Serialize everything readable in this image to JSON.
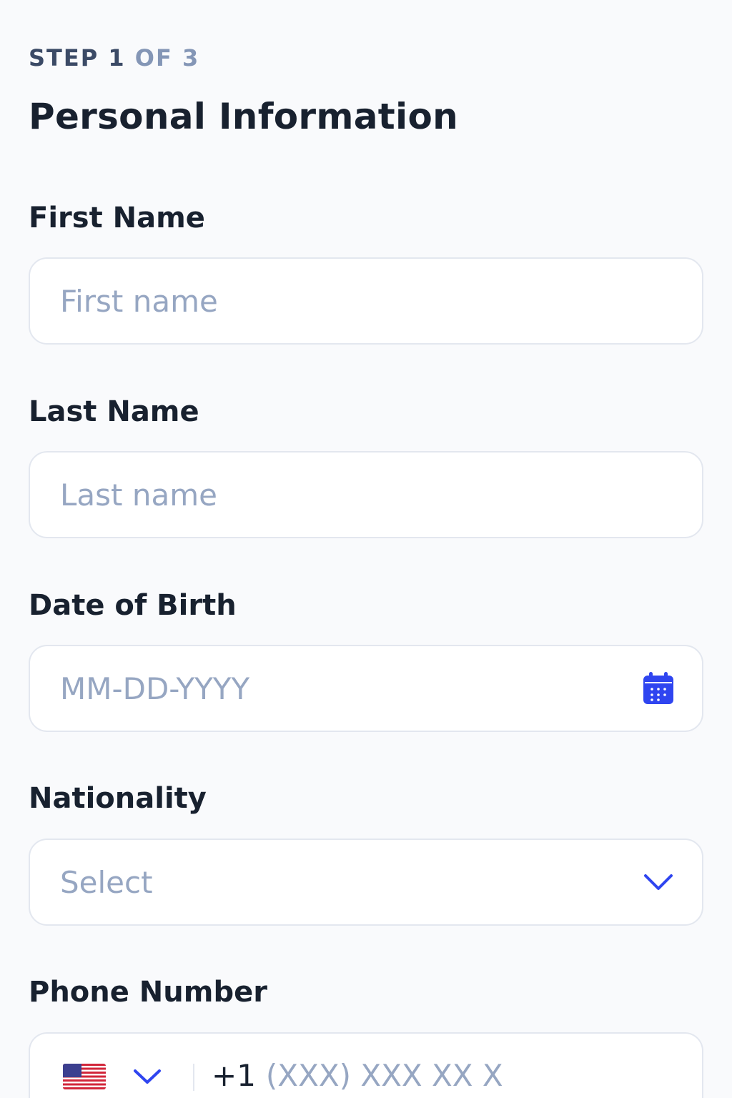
{
  "step": {
    "current_text": "STEP 1",
    "total_text": "OF 3"
  },
  "title": "Personal Information",
  "fields": {
    "first_name": {
      "label": "First Name",
      "placeholder": "First name"
    },
    "last_name": {
      "label": "Last Name",
      "placeholder": "Last name"
    },
    "dob": {
      "label": "Date of Birth",
      "placeholder": "MM-DD-YYYY",
      "icon": "calendar-icon"
    },
    "nationality": {
      "label": "Nationality",
      "placeholder": "Select",
      "icon": "chevron-down-icon"
    },
    "phone": {
      "label": "Phone Number",
      "country_icon": "us-flag-icon",
      "dial_code": "+1",
      "placeholder": "(XXX) XXX XX X"
    }
  },
  "colors": {
    "accent": "#2f45f0",
    "text": "#18212f",
    "placeholder": "#96a6c2",
    "border": "#e3e7ef"
  }
}
